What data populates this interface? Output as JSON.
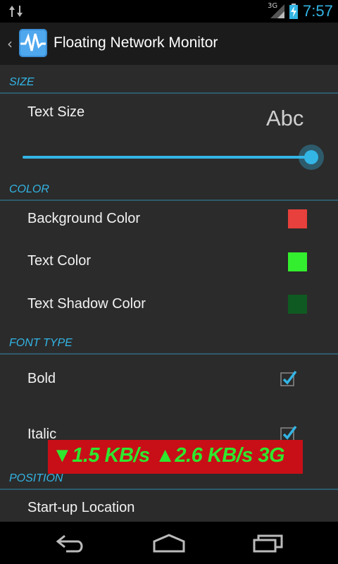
{
  "status_bar": {
    "network_label": "3G",
    "time": "7:57"
  },
  "action_bar": {
    "title": "Floating Network Monitor"
  },
  "sections": {
    "size": "SIZE",
    "color": "COLOR",
    "font_type": "FONT TYPE",
    "position": "POSITION"
  },
  "settings": {
    "text_size": {
      "label": "Text Size",
      "preview": "Abc",
      "slider_level": 1.0
    },
    "background_color": {
      "label": "Background Color",
      "swatch": "#e8403c"
    },
    "text_color": {
      "label": "Text Color",
      "swatch": "#33ee2e"
    },
    "text_shadow_color": {
      "label": "Text Shadow Color",
      "swatch": "#0f5a22"
    },
    "bold": {
      "label": "Bold",
      "checked": true
    },
    "italic": {
      "label": "Italic",
      "checked": true
    },
    "startup_location": {
      "label": "Start-up Location"
    }
  },
  "floating_overlay": {
    "text": "▼1.5 KB/s ▲2.6 KB/s 3G"
  },
  "colors": {
    "accent": "#33b5e5",
    "background": "#2b2b2b",
    "action_bar": "#1b1b1b"
  },
  "icons": {
    "status": [
      "data-transfer-icon",
      "signal-icon",
      "battery-charging-icon"
    ],
    "nav": [
      "back-icon",
      "home-icon",
      "recent-apps-icon"
    ]
  }
}
